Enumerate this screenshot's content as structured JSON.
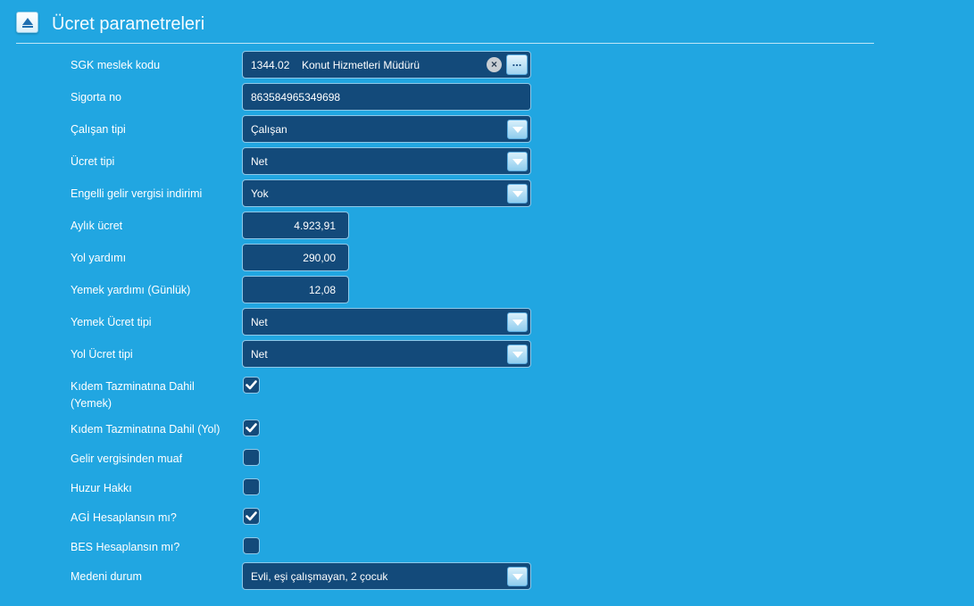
{
  "section": {
    "title": "Ücret parametreleri"
  },
  "fields": {
    "sgk": {
      "label": "SGK meslek kodu",
      "code": "1344.02",
      "name": "Konut Hizmetleri Müdürü",
      "clear": "×",
      "browse": "..."
    },
    "sigorta": {
      "label": "Sigorta no",
      "value": "863584965349698"
    },
    "calisan_tipi": {
      "label": "Çalışan tipi",
      "value": "Çalışan"
    },
    "ucret_tipi": {
      "label": "Ücret tipi",
      "value": "Net"
    },
    "engelli": {
      "label": "Engelli gelir vergisi indirimi",
      "value": "Yok"
    },
    "aylik": {
      "label": "Aylık ücret",
      "value": "4.923,91"
    },
    "yol_yardimi": {
      "label": "Yol yardımı",
      "value": "290,00"
    },
    "yemek_yardimi": {
      "label": "Yemek yardımı (Günlük)",
      "value": "12,08"
    },
    "yemek_ucret_tipi": {
      "label": "Yemek Ücret tipi",
      "value": "Net"
    },
    "yol_ucret_tipi": {
      "label": "Yol Ücret tipi",
      "value": "Net"
    },
    "kidem_yemek": {
      "label_line1": "Kıdem Tazminatına Dahil",
      "label_line2": "(Yemek)",
      "checked": true
    },
    "kidem_yol": {
      "label": "Kıdem Tazminatına Dahil (Yol)",
      "checked": true
    },
    "gelir_muaf": {
      "label": "Gelir vergisinden muaf",
      "checked": false
    },
    "huzur": {
      "label": "Huzur Hakkı",
      "checked": false
    },
    "agi": {
      "label": "AGİ Hesaplansın mı?",
      "checked": true
    },
    "bes": {
      "label": "BES Hesaplansın mı?",
      "checked": false
    },
    "medeni": {
      "label": "Medeni durum",
      "value": "Evli, eşi çalışmayan, 2 çocuk"
    }
  }
}
